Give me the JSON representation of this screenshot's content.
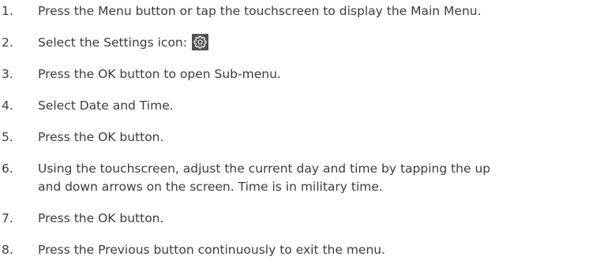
{
  "steps": [
    {
      "num": "1.",
      "text": "Press the Menu button or tap the touchscreen to display the Main Menu."
    },
    {
      "num": "2.",
      "text": "Select the Settings icon:",
      "icon": "settings-gear-icon"
    },
    {
      "num": "3.",
      "text": "Press the OK button to open Sub-menu."
    },
    {
      "num": "4.",
      "text": "Select Date and Time."
    },
    {
      "num": "5.",
      "text": "Press the OK button."
    },
    {
      "num": "6.",
      "line1": "Using the touchscreen, adjust the current day and time by tapping the up",
      "line2": "and down arrows on the screen. Time is in military time."
    },
    {
      "num": "7.",
      "text": "Press the OK button."
    },
    {
      "num": "8.",
      "text": "Press the Previous button continuously to exit the menu."
    }
  ],
  "colors": {
    "text": "#3c3c3c",
    "icon_background": "#505050",
    "icon_foreground": "#ffffff"
  }
}
